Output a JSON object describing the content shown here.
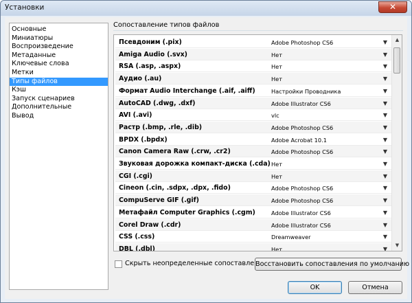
{
  "window": {
    "title": "Установки"
  },
  "nav": {
    "items": [
      "Основные",
      "Миниатюры",
      "Воспроизведение",
      "Метаданные",
      "Ключевые слова",
      "Метки",
      "Типы файлов",
      "Кэш",
      "Запуск сценариев",
      "Дополнительные",
      "Вывод"
    ],
    "selected_index": 6
  },
  "group_label": "Сопоставление типов файлов",
  "file_types": [
    {
      "name": "Псевдоним (.pix)",
      "assoc": "Adobe Photoshop CS6"
    },
    {
      "name": "Amiga Audio (.svx)",
      "assoc": "Нет"
    },
    {
      "name": "RSA (.asp, .aspx)",
      "assoc": "Нет"
    },
    {
      "name": "Аудио (.au)",
      "assoc": "Нет"
    },
    {
      "name": "Формат Audio Interchange (.aif, .aiff)",
      "assoc": "Настройки Проводника"
    },
    {
      "name": "AutoCAD (.dwg, .dxf)",
      "assoc": "Adobe Illustrator CS6"
    },
    {
      "name": "AVI (.avi)",
      "assoc": "vlc"
    },
    {
      "name": "Растр (.bmp, .rle, .dib)",
      "assoc": "Adobe Photoshop CS6"
    },
    {
      "name": "BPDX (.bpdx)",
      "assoc": "Adobe Acrobat 10.1"
    },
    {
      "name": "Canon Camera Raw (.crw, .cr2)",
      "assoc": "Adobe Photoshop CS6"
    },
    {
      "name": "Звуковая дорожка компакт-диска (.cda)",
      "assoc": "Нет"
    },
    {
      "name": "CGI (.cgi)",
      "assoc": "Нет"
    },
    {
      "name": "Cineon (.cin, .sdpx, .dpx, .fido)",
      "assoc": "Adobe Photoshop CS6"
    },
    {
      "name": "CompuServe GIF (.gif)",
      "assoc": "Adobe Photoshop CS6"
    },
    {
      "name": "Метафайл Computer Graphics (.cgm)",
      "assoc": "Adobe Illustrator CS6"
    },
    {
      "name": "Corel Draw (.cdr)",
      "assoc": "Adobe Illustrator CS6"
    },
    {
      "name": "CSS (.css)",
      "assoc": "Dreamweaver"
    },
    {
      "name": "DBL (.dbl)",
      "assoc": "Нет"
    }
  ],
  "hide_undefined_label": "Скрыть неопределенные сопоставления",
  "buttons": {
    "restore": "Восстановить сопоставления по умолчанию",
    "ok": "OK",
    "cancel": "Отмена"
  },
  "icons": {
    "close": "✕",
    "dropdown": "▼",
    "scroll_up": "▲",
    "scroll_down": "▼"
  }
}
